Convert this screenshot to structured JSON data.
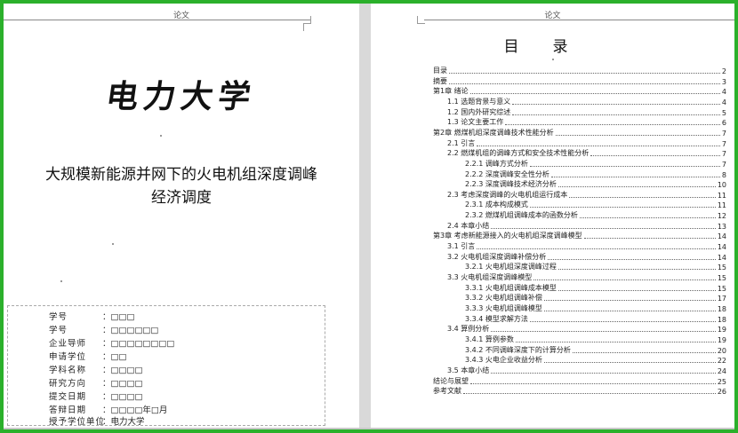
{
  "header_text": "论文",
  "left_page": {
    "university_logo": "电力大学",
    "thesis_title_line1": "大规模新能源并网下的火电机组深度调峰",
    "thesis_title_line2": "经济调度",
    "info": [
      {
        "label": "学号",
        "value": "□□□"
      },
      {
        "label": "学号",
        "value": "□□□□□□"
      },
      {
        "label": "企业导师",
        "value": "□□□□□□□□"
      },
      {
        "label": "申请学位",
        "value": "□□"
      },
      {
        "label": "学科名称",
        "value": "□□□□"
      },
      {
        "label": "研究方向",
        "value": "□□□□"
      },
      {
        "label": "提交日期",
        "value": "□□□□"
      },
      {
        "label": "答辩日期",
        "value": "□□□□年□月"
      },
      {
        "label": "授予学位单位",
        "value": "电力大学"
      }
    ]
  },
  "right_page": {
    "toc_title": "目录",
    "entries": [
      {
        "text": "目录",
        "page": "2"
      },
      {
        "text": "摘要",
        "page": "3"
      },
      {
        "text": "第1章 绪论",
        "page": "4"
      },
      {
        "text": "1.1 选题背景与意义",
        "page": "4"
      },
      {
        "text": "1.2 国内外研究综述",
        "page": "5"
      },
      {
        "text": "1.3 论文主要工作",
        "page": "6"
      },
      {
        "text": "第2章 燃煤机组深度调峰技术性能分析",
        "page": "7"
      },
      {
        "text": "2.1 引言",
        "page": "7"
      },
      {
        "text": "2.2 燃煤机组的调峰方式和安全技术性能分析",
        "page": "7"
      },
      {
        "text": "2.2.1 调峰方式分析",
        "page": "7"
      },
      {
        "text": "2.2.2 深度调峰安全性分析",
        "page": "8"
      },
      {
        "text": "2.2.3 深度调峰技术经济分析",
        "page": "10"
      },
      {
        "text": "2.3 考虑深度调峰的火电机组运行成本",
        "page": "11"
      },
      {
        "text": "2.3.1 成本构成模式",
        "page": "11"
      },
      {
        "text": "2.3.2 燃煤机组调峰成本的函数分析",
        "page": "12"
      },
      {
        "text": "2.4 本章小结",
        "page": "13"
      },
      {
        "text": "第3章 考虑新能源接入的火电机组深度调峰模型",
        "page": "14"
      },
      {
        "text": "3.1 引言",
        "page": "14"
      },
      {
        "text": "3.2 火电机组深度调峰补偿分析",
        "page": "14"
      },
      {
        "text": "3.2.1 火电机组深度调峰过程",
        "page": "15"
      },
      {
        "text": "3.3 火电机组深度调峰模型",
        "page": "15"
      },
      {
        "text": "3.3.1 火电机组调峰成本模型",
        "page": "15"
      },
      {
        "text": "3.3.2 火电机组调峰补偿",
        "page": "17"
      },
      {
        "text": "3.3.3 火电机组调峰模型",
        "page": "18"
      },
      {
        "text": "3.3.4 模型求解方法",
        "page": "18"
      },
      {
        "text": "3.4 算例分析",
        "page": "19"
      },
      {
        "text": "3.4.1 算例参数",
        "page": "19"
      },
      {
        "text": "3.4.2 不同调峰深度下的计算分析",
        "page": "20"
      },
      {
        "text": "3.4.3 火电企业收益分析",
        "page": "22"
      },
      {
        "text": "3.5 本章小结",
        "page": "24"
      },
      {
        "text": "结论与展望",
        "page": "25"
      },
      {
        "text": "参考文献",
        "page": "26"
      }
    ]
  }
}
